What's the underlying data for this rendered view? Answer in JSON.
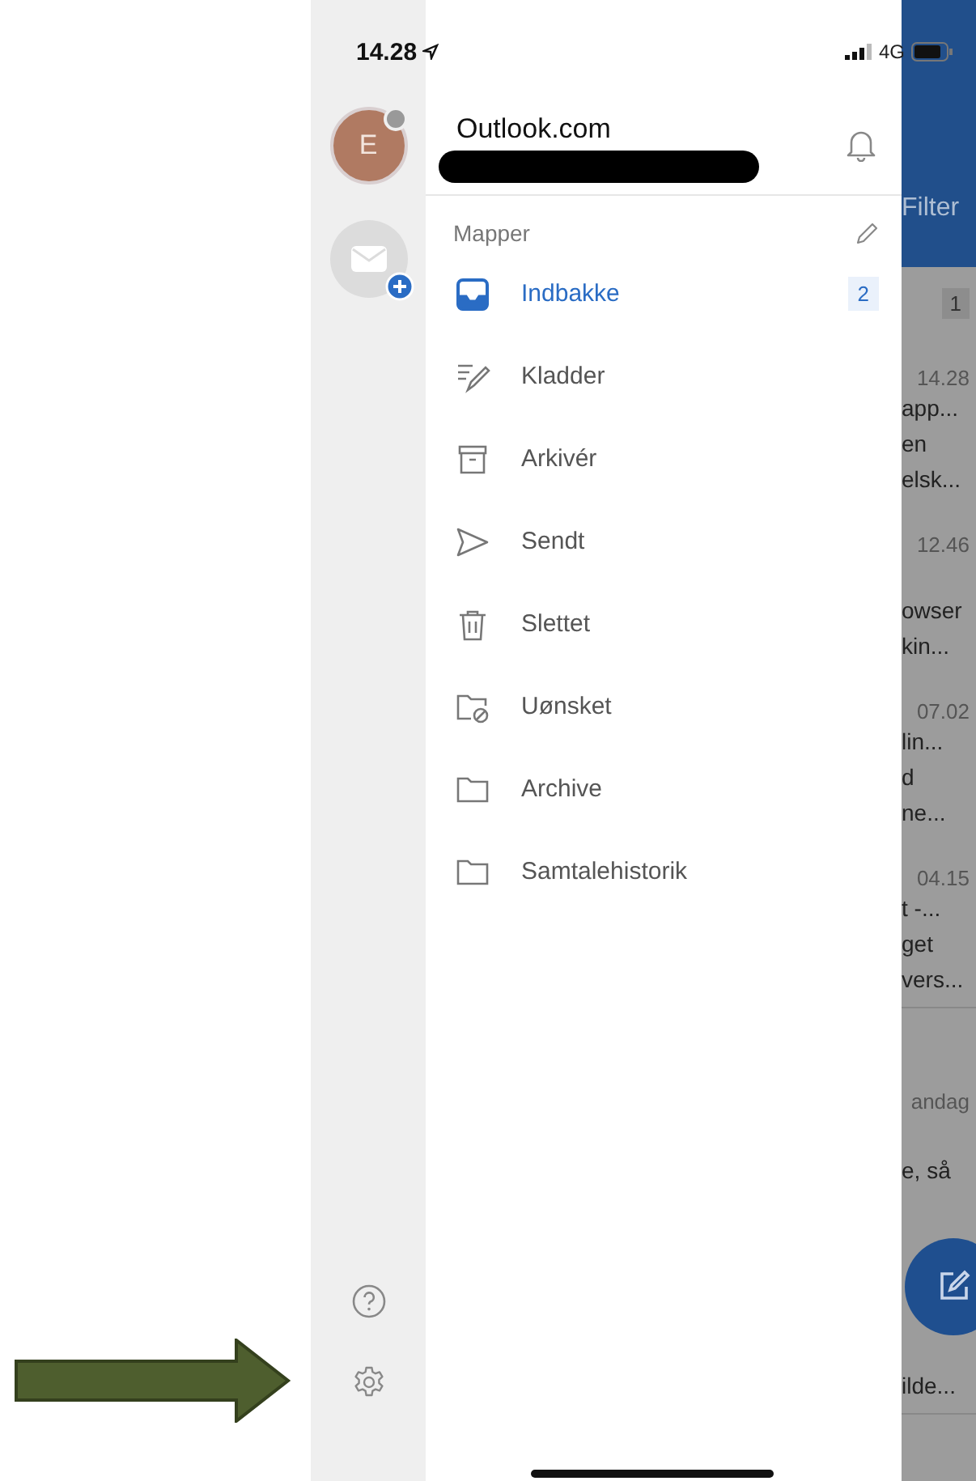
{
  "status_bar": {
    "time": "14.28",
    "network": "4G"
  },
  "rail": {
    "avatar_initial": "E"
  },
  "drawer": {
    "account_title": "Outlook.com",
    "section_title": "Mapper",
    "folders": [
      {
        "kind": "inbox",
        "label": "Indbakke",
        "selected": true,
        "count": "2"
      },
      {
        "kind": "drafts",
        "label": "Kladder",
        "selected": false
      },
      {
        "kind": "archive",
        "label": "Arkivér",
        "selected": false
      },
      {
        "kind": "sent",
        "label": "Sendt",
        "selected": false
      },
      {
        "kind": "trash",
        "label": "Slettet",
        "selected": false
      },
      {
        "kind": "junk",
        "label": "Uønsket",
        "selected": false
      },
      {
        "kind": "folder",
        "label": "Archive",
        "selected": false
      },
      {
        "kind": "folder",
        "label": "Samtalehistorik",
        "selected": false
      }
    ]
  },
  "background_list": {
    "filter_label": "Filter",
    "unread_count": "1",
    "messages": [
      {
        "time": "14.28",
        "lines": [
          "app...",
          "en",
          "elsk..."
        ]
      },
      {
        "time": "12.46",
        "lines": [
          "owser",
          "kin..."
        ]
      },
      {
        "time": "07.02",
        "lines": [
          "lin...",
          "d",
          "ne..."
        ]
      },
      {
        "time": "04.15",
        "lines": [
          "t -...",
          "get",
          "vers..."
        ]
      },
      {
        "time": "andag",
        "lines": [
          "e, så"
        ]
      },
      {
        "lines": [
          "ilde..."
        ]
      }
    ]
  }
}
